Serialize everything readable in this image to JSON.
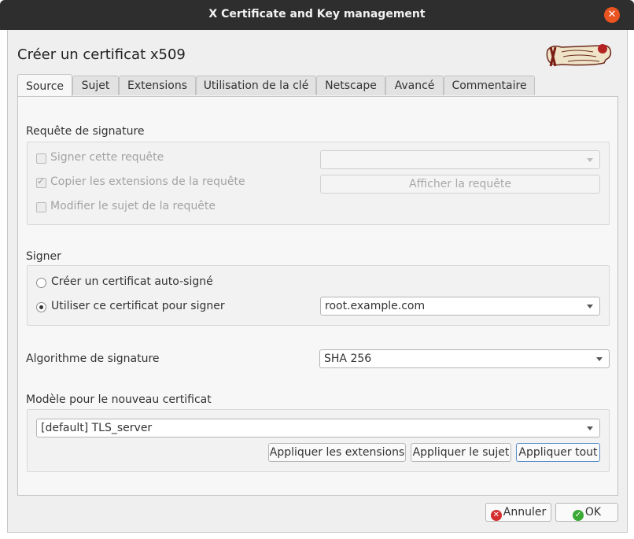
{
  "window": {
    "title": "X Certificate and Key management"
  },
  "dialog": {
    "heading": "Créer un certificat x509",
    "tabs": [
      {
        "label": "Source"
      },
      {
        "label": "Sujet"
      },
      {
        "label": "Extensions"
      },
      {
        "label": "Utilisation de la clé"
      },
      {
        "label": "Netscape"
      },
      {
        "label": "Avancé"
      },
      {
        "label": "Commentaire"
      }
    ],
    "active_tab": "Source"
  },
  "signing_request": {
    "section_label": "Requête de signature",
    "sign_request_label": "Signer cette requête",
    "copy_extensions_label": "Copier les extensions de la requête",
    "modify_subject_label": "Modifier le sujet de la requête",
    "copy_extensions_checked": true,
    "request_select_value": "",
    "show_request_label": "Afficher la requête"
  },
  "signing": {
    "section_label": "Signer",
    "self_signed_label": "Créer un certificat auto-signé",
    "use_cert_label": "Utiliser ce certificat pour signer",
    "selected_option": "use_cert",
    "cert_select_value": "root.example.com"
  },
  "algorithm": {
    "label": "Algorithme de signature",
    "value": "SHA 256"
  },
  "template": {
    "section_label": "Modèle pour le nouveau certificat",
    "value": "[default] TLS_server",
    "apply_extensions_label": "Appliquer les extensions",
    "apply_subject_label": "Appliquer le sujet",
    "apply_all_label": "Appliquer tout"
  },
  "footer": {
    "cancel_label": "Annuler",
    "ok_label": "OK",
    "cancel_icon": "cancel-icon",
    "ok_icon": "ok-icon"
  },
  "colors": {
    "titlebar": "#2e2e2e",
    "close_button": "#e95420",
    "cancel_icon": "#d32f2f",
    "ok_icon": "#3aa935"
  }
}
